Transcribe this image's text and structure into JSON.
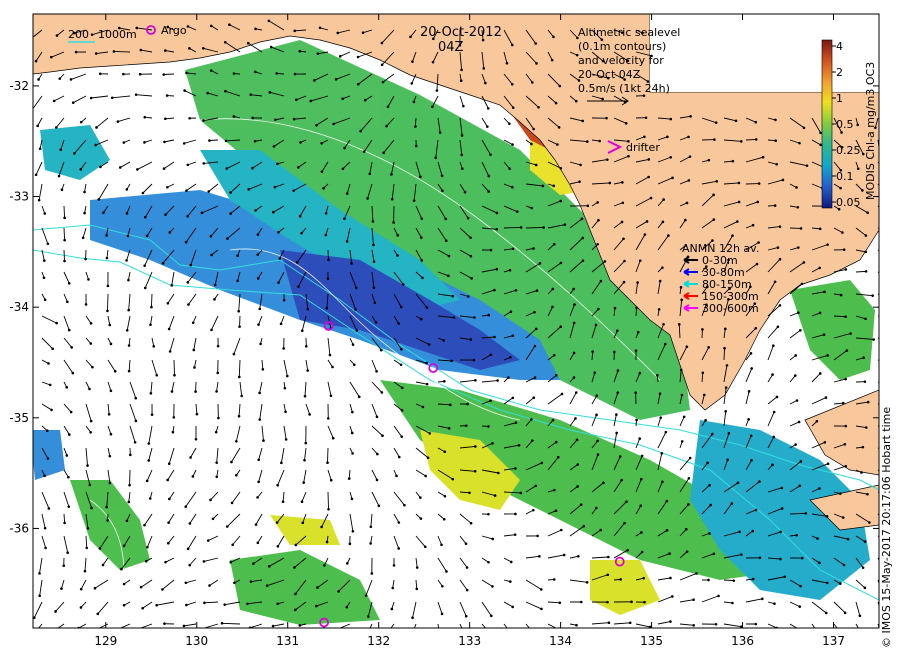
{
  "header": {
    "date": "20-Oct-2012",
    "time": "04Z",
    "bathy_legend": {
      "label_200": "200",
      "label_1000": "1000m"
    },
    "argo_label": "Argo",
    "drifter_label": "drifter"
  },
  "altimetry_note": {
    "line1": "Altimetric sealevel",
    "line2": "(0.1m contours)",
    "line3": "and velocity for",
    "line4": "20-Oct 04Z",
    "line5": "0.5m/s (1kt 24h)"
  },
  "colorbar": {
    "title": "MODIS Chl-a mg/m3 OC3",
    "ticks": [
      "4",
      "2",
      "1",
      "0.5",
      "0.25",
      "0.1",
      "0.05"
    ]
  },
  "anmn_legend": {
    "title": "ANMN 12h av.",
    "items": [
      {
        "label": "0-30m",
        "color": "#000000"
      },
      {
        "label": "30-80m",
        "color": "#0000ff"
      },
      {
        "label": "80-150m",
        "color": "#00dddd"
      },
      {
        "label": "150-300m",
        "color": "#ff0000"
      },
      {
        "label": "300-600m",
        "color": "#ff00ff"
      }
    ]
  },
  "axes": {
    "x_ticks": [
      "129",
      "130",
      "131",
      "132",
      "133",
      "134",
      "135",
      "136",
      "137"
    ],
    "y_ticks": [
      "-32",
      "-33",
      "-34",
      "-35",
      "-36"
    ],
    "x_range": [
      128.2,
      137.5
    ],
    "y_range": [
      -36.9,
      -31.35
    ]
  },
  "credit": "© IMOS 15-May-2017 20:17:06 Hobart time",
  "colors": {
    "land": "#f8c89c",
    "chl_low": "#1f40c8",
    "chl_mid": "#19b4c0",
    "chl_green": "#44bb44",
    "chl_yellow": "#e8e020",
    "chl_high": "#c84010",
    "bathy": "#33dddd",
    "argo": "#dd00dd"
  },
  "argo_floats": [
    {
      "lon": 131.45,
      "lat": -34.17
    },
    {
      "lon": 132.6,
      "lat": -34.55
    },
    {
      "lon": 134.65,
      "lat": -36.3
    },
    {
      "lon": 131.4,
      "lat": -36.85
    }
  ],
  "drifter": {
    "lon": 134.6,
    "lat": -32.55
  }
}
